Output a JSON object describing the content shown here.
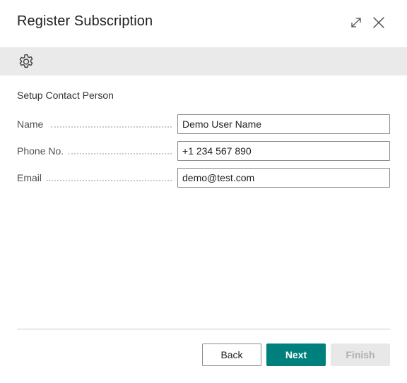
{
  "dialog": {
    "title": "Register Subscription",
    "icons": {
      "expand": "expand-icon",
      "close": "close-icon",
      "settings": "gear-icon"
    }
  },
  "section": {
    "title": "Setup Contact Person"
  },
  "fields": [
    {
      "label": "Name",
      "value": "Demo User Name"
    },
    {
      "label": "Phone No.",
      "value": "+1 234 567 890"
    },
    {
      "label": "Email",
      "value": "demo@test.com"
    }
  ],
  "buttons": {
    "back": "Back",
    "next": "Next",
    "finish": "Finish",
    "finish_enabled": false
  },
  "colors": {
    "accent": "#00807d",
    "toolbar_bg": "#eaeaea"
  }
}
